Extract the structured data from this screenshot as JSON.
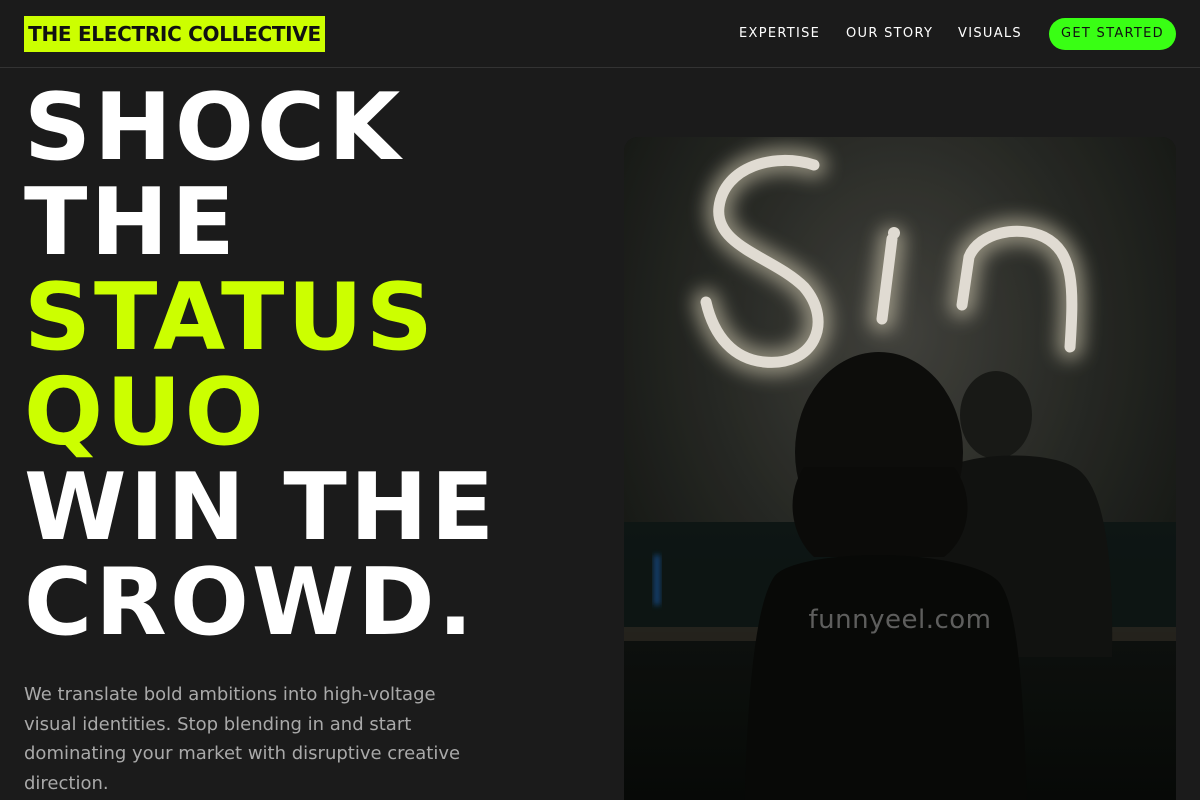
{
  "brand": {
    "name": "THE ELECTRIC COLLECTIVE"
  },
  "nav": {
    "items": [
      "EXPERTISE",
      "OUR STORY",
      "VISUALS"
    ],
    "cta_label": "GET STARTED"
  },
  "hero": {
    "headline_lines": [
      "SHOCK",
      "THE",
      "STATUS",
      "QUO",
      "WIN THE",
      "CROWD."
    ],
    "body": "We translate bold ambitions into high-voltage visual identities. Stop blending in and start dominating your market with disruptive creative direction."
  },
  "photo": {
    "neon_text": "Sin",
    "watermark": "funnyeel.com"
  },
  "colors": {
    "background": "#1b1b1b",
    "accent_lime": "#ccff00",
    "cta_green": "#39ff14",
    "body_text": "#a9a9a9",
    "white": "#ffffff"
  }
}
